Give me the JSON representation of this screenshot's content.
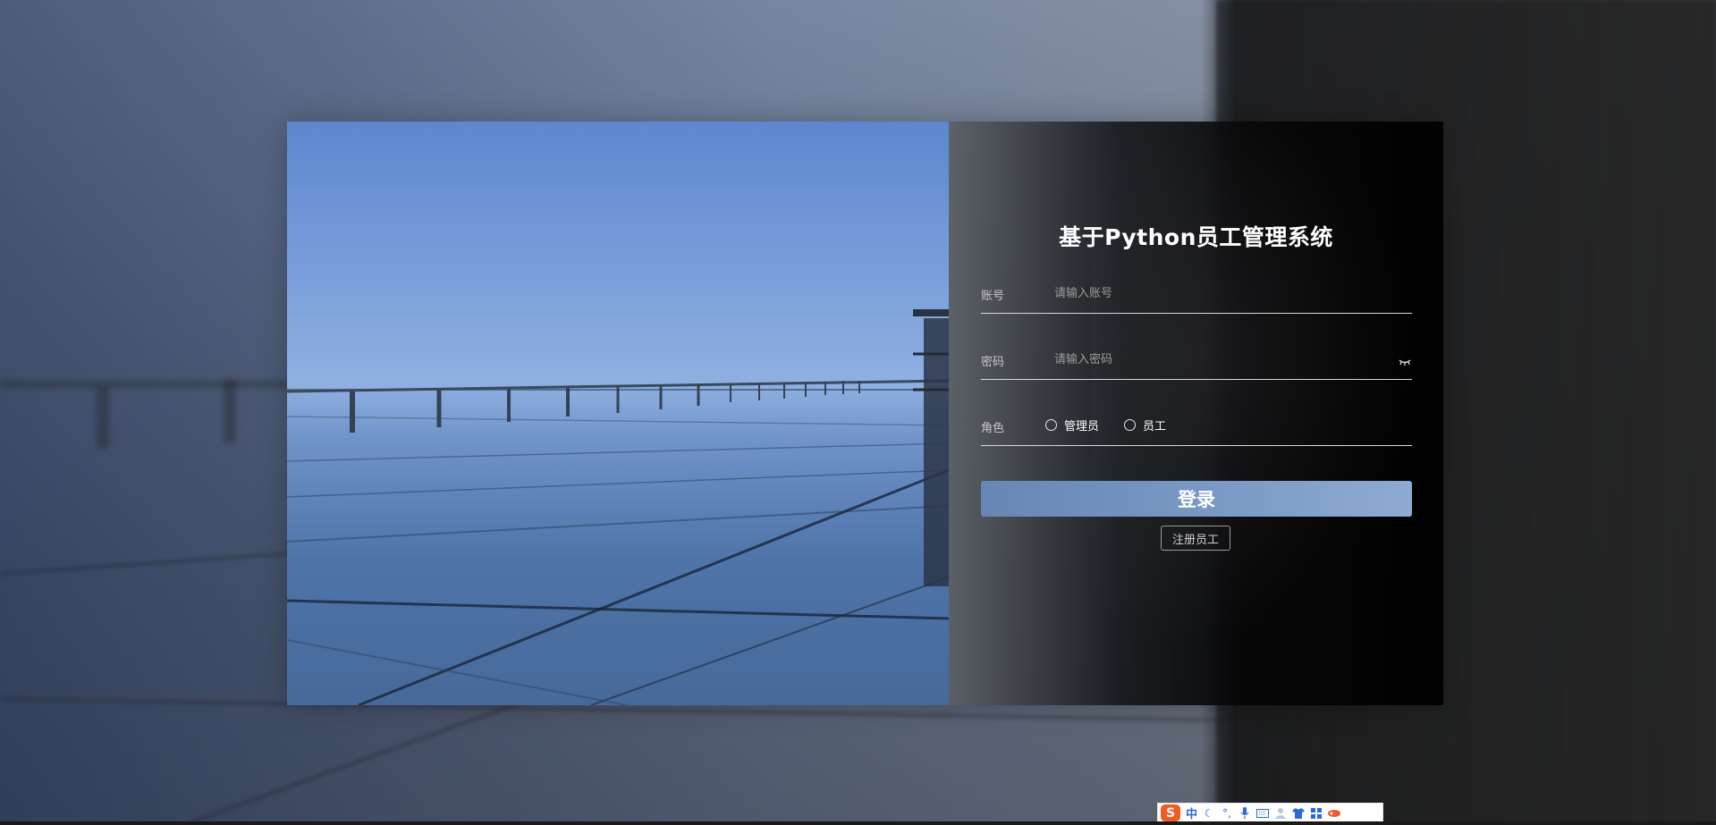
{
  "login": {
    "title": "基于Python员工管理系统",
    "account_label": "账号",
    "account_placeholder": "请输入账号",
    "account_value": "",
    "password_label": "密码",
    "password_placeholder": "请输入密码",
    "password_value": "",
    "role_label": "角色",
    "roles": [
      {
        "label": "管理员",
        "selected": false
      },
      {
        "label": "员工",
        "selected": false
      }
    ],
    "login_button": "登录",
    "register_button": "注册员工"
  },
  "ime_toolbar": {
    "logo": "S",
    "mode_label": "中",
    "icons": [
      "moon-icon",
      "punctuation-icon",
      "microphone-icon",
      "keyboard-icon",
      "user-icon",
      "shirt-icon",
      "grid-icon",
      "tools-icon"
    ]
  },
  "colors": {
    "login_button": "#7c9cc7",
    "ime_logo": "#f25a24",
    "ime_accent": "#2a6ad8"
  }
}
